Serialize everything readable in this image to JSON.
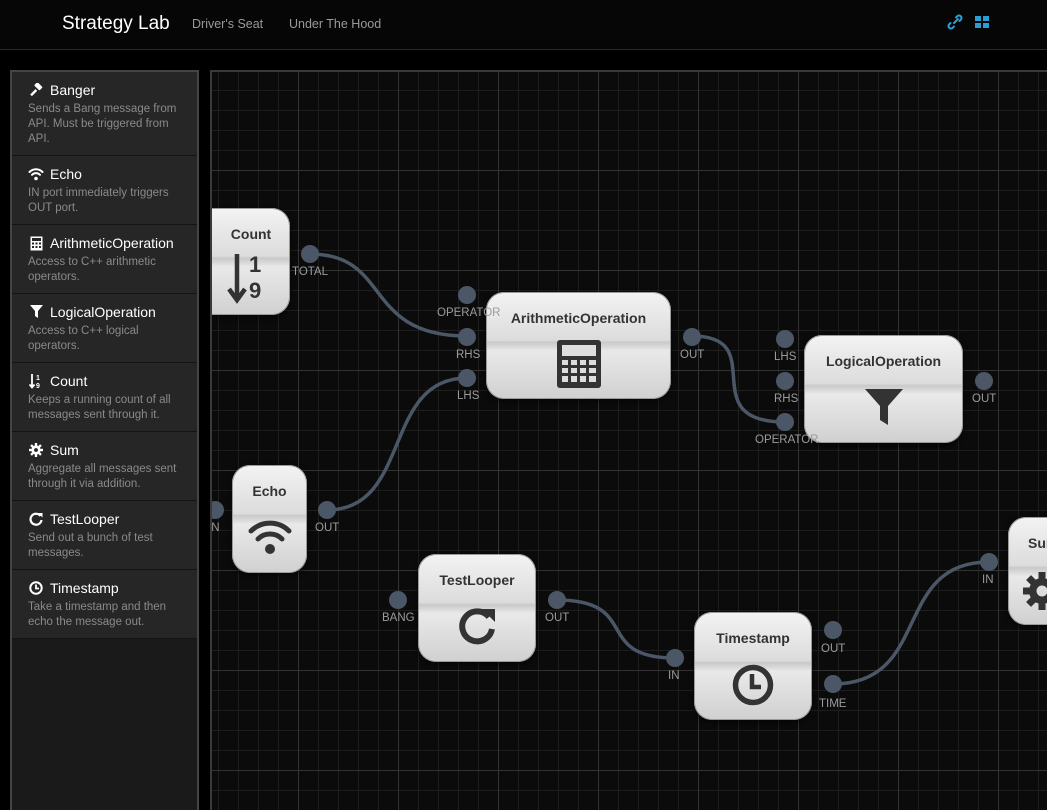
{
  "navbar": {
    "brand": "Strategy Lab",
    "links": [
      "Driver's Seat",
      "Under The Hood"
    ],
    "icons": [
      "link-icon",
      "grid-icon"
    ],
    "accent": "#2a9fd6"
  },
  "sidebar": {
    "items": [
      {
        "title": "Banger",
        "icon": "gavel-icon",
        "desc": "Sends a Bang message from API. Must be triggered from API."
      },
      {
        "title": "Echo",
        "icon": "wifi-icon",
        "desc": "IN port immediately triggers OUT port."
      },
      {
        "title": "ArithmeticOperation",
        "icon": "calculator-icon",
        "desc": "Access to C++ arithmetic operators."
      },
      {
        "title": "LogicalOperation",
        "icon": "filter-icon",
        "desc": "Access to C++ logical operators."
      },
      {
        "title": "Count",
        "icon": "sort-numeric-icon",
        "desc": "Keeps a running count of all messages sent through it."
      },
      {
        "title": "Sum",
        "icon": "gear-icon",
        "desc": "Aggregate all messages sent through it via addition."
      },
      {
        "title": "TestLooper",
        "icon": "refresh-icon",
        "desc": "Send out a bunch of test messages."
      },
      {
        "title": "Timestamp",
        "icon": "clock-icon",
        "desc": "Take a timestamp and then echo the message out."
      }
    ]
  },
  "canvas": {
    "port_color": "#4b5666",
    "nodes": {
      "count": {
        "title": "Count",
        "digit_top": "1",
        "digit_bottom": "9",
        "ports": {
          "total": "TOTAL"
        }
      },
      "arith": {
        "title": "ArithmeticOperation",
        "ports": {
          "operator": "OPERATOR",
          "rhs": "RHS",
          "lhs": "LHS",
          "out": "OUT"
        }
      },
      "logical": {
        "title": "LogicalOperation",
        "ports": {
          "lhs": "LHS",
          "rhs": "RHS",
          "operator": "OPERATOR",
          "out": "OUT"
        }
      },
      "echo": {
        "title": "Echo",
        "ports": {
          "in": "IN",
          "out": "OUT"
        }
      },
      "testlooper": {
        "title": "TestLooper",
        "ports": {
          "bang": "BANG",
          "out": "OUT"
        }
      },
      "timestamp": {
        "title": "Timestamp",
        "ports": {
          "in": "IN",
          "out": "OUT",
          "time": "TIME"
        }
      },
      "sum": {
        "title": "Sum",
        "ports": {
          "in": "IN"
        }
      }
    }
  }
}
